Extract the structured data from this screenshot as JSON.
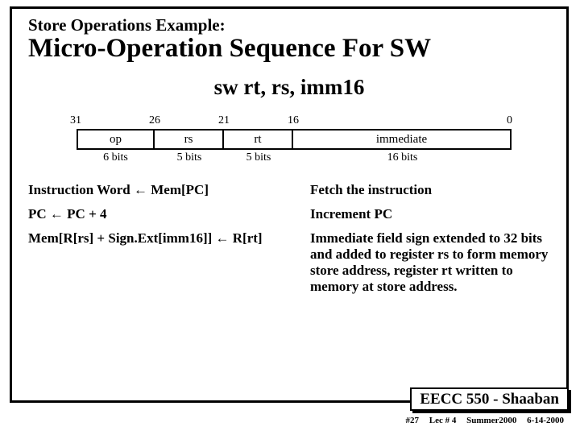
{
  "header": {
    "subtitle": "Store Operations Example:",
    "title": "Micro-Operation Sequence For  SW"
  },
  "mnemonic": "sw rt, rs, imm16",
  "bitfield": {
    "positions": {
      "p31": "31",
      "p26": "26",
      "p21": "21",
      "p16": "16",
      "p0": "0"
    },
    "fields": {
      "op": "op",
      "rs": "rs",
      "rt": "rt",
      "imm": "immediate"
    },
    "widths": {
      "op": "6 bits",
      "rs": "5 bits",
      "rt": "5 bits",
      "imm": "16 bits"
    }
  },
  "uops": {
    "r1": {
      "left_a": "Instruction Word ",
      "arrow1": "←",
      "left_b": "     Mem[PC]",
      "right": "Fetch the instruction"
    },
    "r2": {
      "left_a": "PC ",
      "arrow1": "←",
      "left_b": "  PC + 4",
      "right": "Increment PC"
    },
    "r3": {
      "left_a": "Mem[R[rs] + Sign.Ext[imm16]]  ",
      "arrow1": "←",
      "left_b": "  R[rt]",
      "right": "Immediate field sign extended to 32 bits and added to register  rs to form memory store address, register  rt  written to memory at store address."
    }
  },
  "footer": {
    "course": "EECC 550 - Shaaban",
    "slide_no": "#27",
    "lecture": "Lec # 4",
    "term": "Summer2000",
    "date": "6-14-2000"
  }
}
